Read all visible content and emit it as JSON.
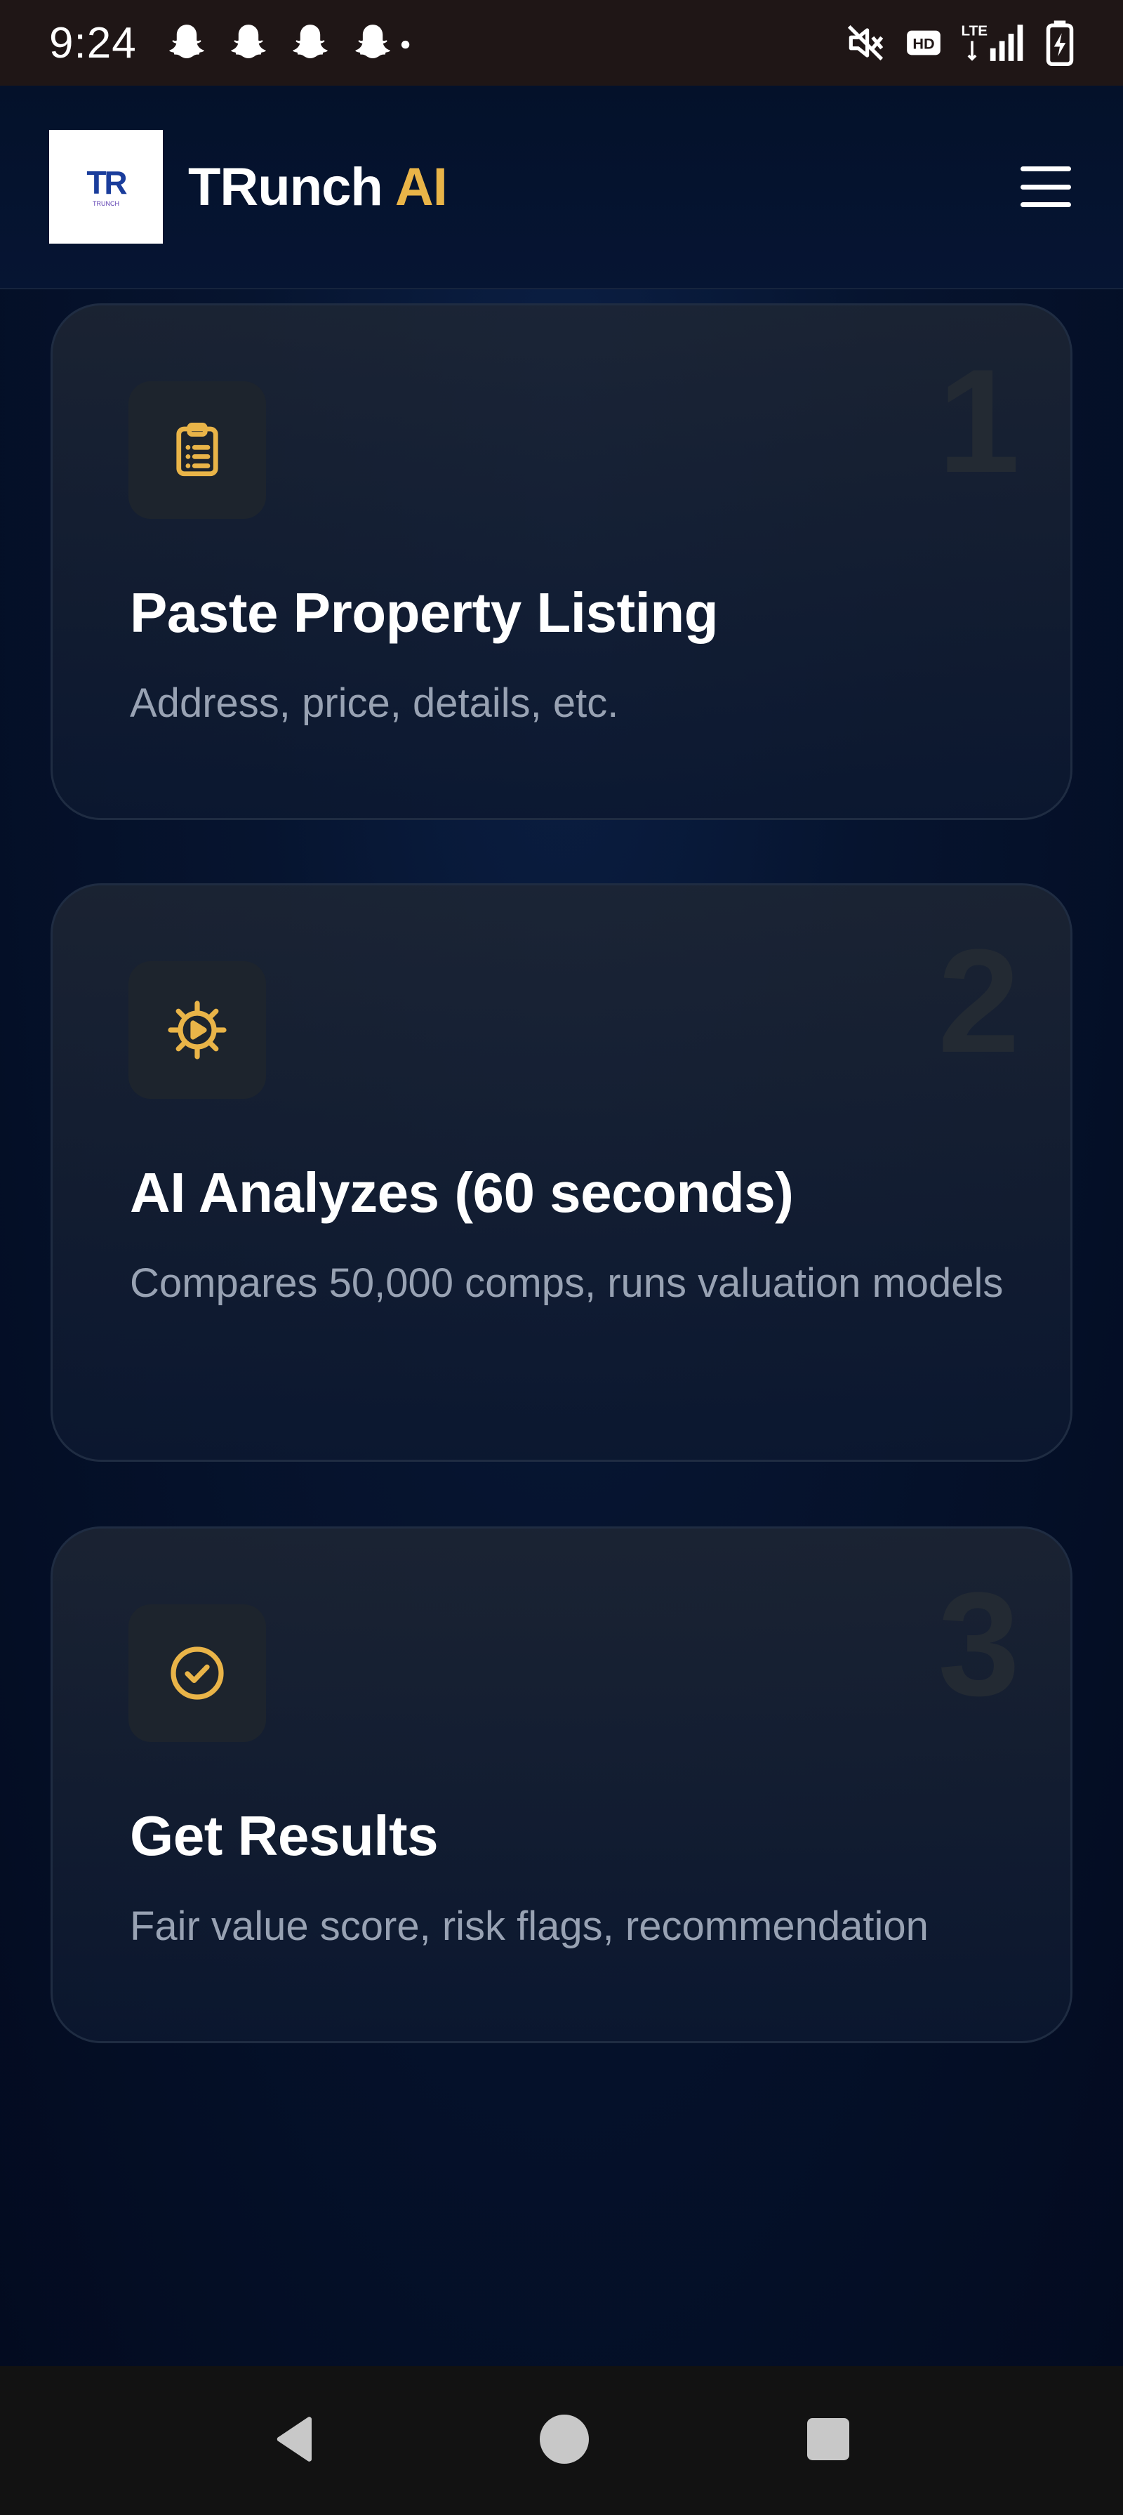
{
  "status_bar": {
    "time": "9:24",
    "notification_icons": [
      "snapchat-icon",
      "snapchat-icon",
      "snapchat-icon",
      "snapchat-icon"
    ],
    "right_icons": [
      "mute-icon",
      "hd-icon",
      "lte-icon",
      "signal-icon",
      "battery-charging-icon"
    ]
  },
  "header": {
    "logo_text": "TR",
    "logo_sub": "TRUNCH",
    "brand_name": "TRunch",
    "brand_accent": "AI",
    "menu_icon": "hamburger-menu-icon"
  },
  "steps": [
    {
      "number": "1",
      "icon": "clipboard-icon",
      "title": "Paste Property Listing",
      "description": "Address, price, details, etc."
    },
    {
      "number": "2",
      "icon": "gear-icon",
      "title": "AI Analyzes (60 seconds)",
      "description": "Compares 50,000 comps, runs valuation models"
    },
    {
      "number": "3",
      "icon": "check-circle-icon",
      "title": "Get Results",
      "description": "Fair value score, risk flags, recommendation"
    }
  ],
  "nav_bar": {
    "buttons": [
      "back-icon",
      "home-icon",
      "recents-icon"
    ]
  },
  "colors": {
    "accent": "#e9b448",
    "background": "#030b20",
    "card_border": "#1f2c42",
    "muted_text": "#98a2b3"
  }
}
